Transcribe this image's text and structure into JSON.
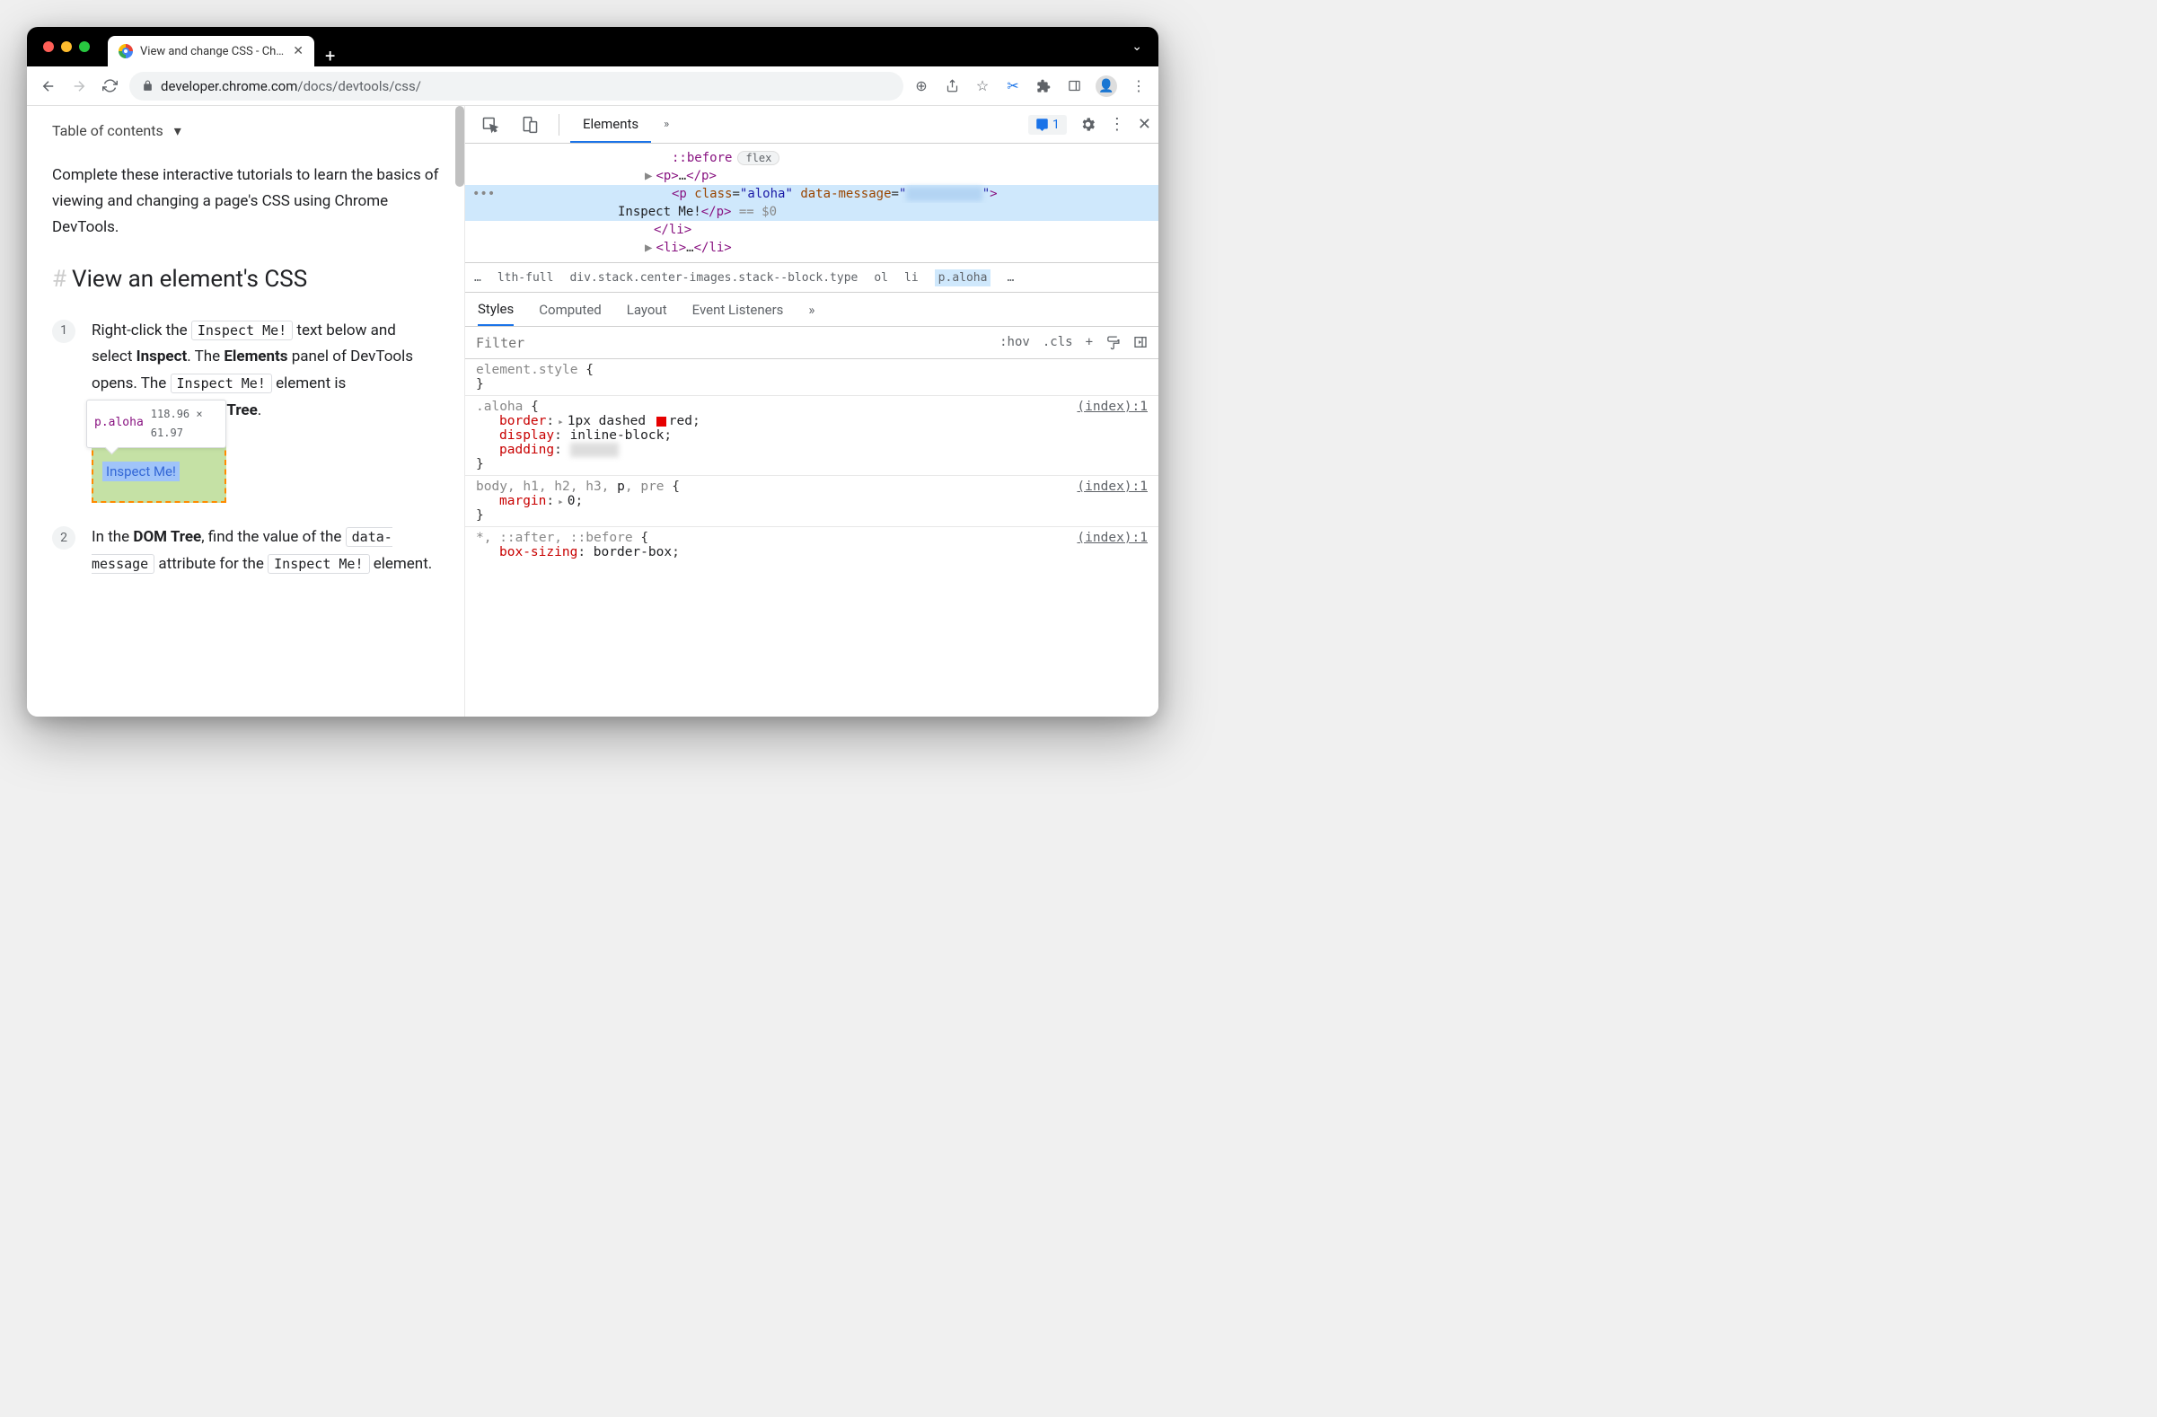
{
  "tab": {
    "title": "View and change CSS - Chrom"
  },
  "url": {
    "domain": "developer.chrome.com",
    "path": "/docs/devtools/css/"
  },
  "page": {
    "toc": "Table of contents",
    "intro": "Complete these interactive tutorials to learn the basics of viewing and changing a page's CSS using Chrome DevTools.",
    "heading": "View an element's CSS",
    "step1_a": "Right-click the ",
    "step1_code1": "Inspect Me!",
    "step1_b": " text below and select ",
    "step1_bold1": "Inspect",
    "step1_c": ". The ",
    "step1_bold2": "Elements",
    "step1_d": " panel of DevTools opens. The ",
    "step1_code2": "Inspect Me!",
    "step1_e": " element is",
    "step1_tail": "OM Tree",
    "step2_a": "In the ",
    "step2_bold1": "DOM Tree",
    "step2_b": ", find the value of the ",
    "step2_code1": "data-message",
    "step2_c": " attribute for the ",
    "step2_code2": "Inspect Me!",
    "step2_d": " element.",
    "tooltip_sel": "p.aloha",
    "tooltip_dim": "118.96 × 61.97",
    "inspect_text": "Inspect Me!"
  },
  "devtools": {
    "tab_elements": "Elements",
    "issues_count": "1",
    "dom": {
      "before": "::before",
      "before_badge": "flex",
      "p_collapsed": "…",
      "sel_class": "aloha",
      "sel_attr": "data-message",
      "sel_text": "Inspect Me!",
      "dollar": "== $0",
      "li_close": "</li>",
      "li_next": "…"
    },
    "crumbs": {
      "dots": "…",
      "c1": "lth-full",
      "c2": "div.stack.center-images.stack--block.type",
      "c3": "ol",
      "c4": "li",
      "c5": "p.aloha",
      "c6": "…"
    },
    "subtabs": {
      "styles": "Styles",
      "computed": "Computed",
      "layout": "Layout",
      "listeners": "Event Listeners"
    },
    "filter": {
      "placeholder": "Filter",
      "hov": ":hov",
      "cls": ".cls"
    },
    "rules": {
      "r0_sel": "element.style",
      "r1_sel": ".aloha",
      "r1_link": "(index):1",
      "r1_p1n": "border",
      "r1_p1v": "1px dashed ",
      "r1_p1v2": "red",
      "r1_p2n": "display",
      "r1_p2v": "inline-block",
      "r1_p3n": "padding",
      "r2_sel_a": "body, h1, h2, h3, ",
      "r2_sel_match": "p",
      "r2_sel_b": ", pre",
      "r2_link": "(index):1",
      "r2_p1n": "margin",
      "r2_p1v": "0",
      "r3_sel": "*, ::after, ::before",
      "r3_link": "(index):1",
      "r3_p1n": "box-sizing",
      "r3_p1v": "border-box"
    }
  }
}
